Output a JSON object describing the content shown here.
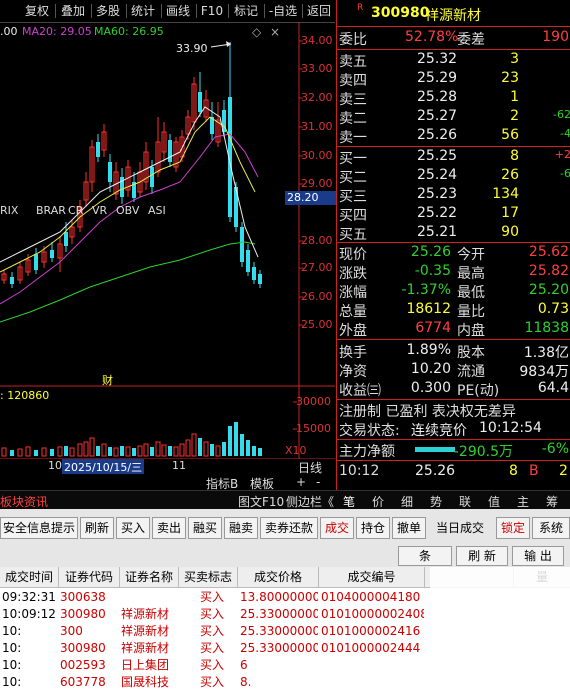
{
  "toolbar": {
    "buttons": [
      "复权",
      "叠加",
      "多股",
      "统计",
      "画线",
      "F10",
      "标记",
      "-自选",
      "返回"
    ]
  },
  "chart": {
    "ma_legend": {
      "ma_prev": ".00",
      "ma20": "MA20: 29.05",
      "ma60": "MA60: 26.95"
    },
    "high_marker": "33.90",
    "price_axis": [
      "34.00",
      "33.00",
      "32.00",
      "31.00",
      "30.00",
      "29.00",
      "28.00",
      "27.00",
      "26.00",
      "25.00",
      "24.00"
    ],
    "current_price_tag": "28.20",
    "indicator_tags": [
      "RIX",
      "BRAR",
      "CR",
      "VR",
      "OBV",
      "ASI"
    ],
    "financial_marker": "财",
    "volume_label": ": 120860",
    "volume_axis": [
      "30000",
      "15000"
    ],
    "volume_scale": "X10",
    "date_row": {
      "left": "10",
      "date": "2025/10/15/三",
      "right": "11"
    },
    "bottom_buttons": [
      "指标B",
      "模板",
      "+",
      "-",
      "日线"
    ]
  },
  "quote": {
    "badge": "R",
    "code": "300980",
    "name": "祥源新材",
    "weibi_label": "委比",
    "weibi_value": "52.78%",
    "weicha_label": "委差",
    "weicha_value": "190",
    "asks": [
      {
        "label": "卖五",
        "price": "25.32",
        "vol": "3",
        "chg": ""
      },
      {
        "label": "卖四",
        "price": "25.29",
        "vol": "23",
        "chg": ""
      },
      {
        "label": "卖三",
        "price": "25.28",
        "vol": "1",
        "chg": ""
      },
      {
        "label": "卖二",
        "price": "25.27",
        "vol": "2",
        "chg": "-62"
      },
      {
        "label": "卖一",
        "price": "25.26",
        "vol": "56",
        "chg": "-4"
      }
    ],
    "bids": [
      {
        "label": "买一",
        "price": "25.25",
        "vol": "8",
        "chg": "+2"
      },
      {
        "label": "买二",
        "price": "25.24",
        "vol": "26",
        "chg": "-6"
      },
      {
        "label": "买三",
        "price": "25.23",
        "vol": "134",
        "chg": ""
      },
      {
        "label": "买四",
        "price": "25.22",
        "vol": "17",
        "chg": ""
      },
      {
        "label": "买五",
        "price": "25.21",
        "vol": "90",
        "chg": ""
      }
    ],
    "stats": [
      {
        "l1": "现价",
        "v1": "25.26",
        "l2": "今开",
        "v2": "25.62"
      },
      {
        "l1": "涨跌",
        "v1": "-0.35",
        "l2": "最高",
        "v2": "25.82"
      },
      {
        "l1": "涨幅",
        "v1": "-1.37%",
        "l2": "最低",
        "v2": "25.20"
      },
      {
        "l1": "总量",
        "v1": "18612",
        "l2": "量比",
        "v2": "0.73"
      },
      {
        "l1": "外盘",
        "v1": "6774",
        "l2": "内盘",
        "v2": "11838"
      }
    ],
    "stats2": [
      {
        "l1": "换手",
        "v1": "1.89%",
        "l2": "股本",
        "v2": "1.38亿"
      },
      {
        "l1": "净资",
        "v1": "10.20",
        "l2": "流通",
        "v2": "9834万"
      },
      {
        "l1": "收益㈢",
        "v1": "0.300",
        "l2": "PE(动)",
        "v2": "64.4"
      }
    ],
    "registration": "注册制 已盈利 表决权无差异",
    "trade_status_label": "交易状态:",
    "trade_status_value": "连续竞价",
    "trade_status_time": "10:12:54",
    "main_net_label": "主力净额",
    "main_net_value": "-290.5万",
    "main_net_pct": "-6%",
    "tick": {
      "time": "10:12",
      "price": "25.26",
      "vol": "8",
      "side": "B",
      "n": "2"
    }
  },
  "tabs": {
    "left": "板块资讯",
    "mid": [
      "图文F10",
      "侧边栏《"
    ],
    "right": [
      "笔",
      "价",
      "细",
      "势",
      "联",
      "值",
      "主",
      "筹"
    ]
  },
  "trade": {
    "buttons": [
      "安全信息提示",
      "刷新",
      "买入",
      "卖出",
      "融买",
      "融卖",
      "卖券还款",
      "成交",
      "持仓",
      "撤单",
      "当日成交",
      "锁定",
      "系统"
    ],
    "actions": [
      "条",
      "刷 新",
      "输 出"
    ],
    "headers": [
      "成交时间",
      "证券代码",
      "证券名称",
      "买卖标志",
      "成交价格",
      "成交编号",
      "",
      "",
      "量"
    ],
    "rows": [
      {
        "time": "09:32:31",
        "code": "300638",
        "name": "",
        "side": "买入",
        "price": "13.80000000",
        "no": "0104000004180"
      },
      {
        "time": "10:09:12",
        "code": "300980",
        "name": "祥源新材",
        "side": "买入",
        "price": "25.33000000",
        "no": "01010000002408"
      },
      {
        "time": "10:",
        "code": "300",
        "name": "祥源新材",
        "side": "买入",
        "price": "25.33000000",
        "no": "0101000002416"
      },
      {
        "time": "10:",
        "code": "300980",
        "name": "祥源新材",
        "side": "买入",
        "price": "25.33000000",
        "no": "0101000002444"
      },
      {
        "time": "10:",
        "code": "002593",
        "name": "日上集团",
        "side": "买入",
        "price": "6",
        "no": ""
      },
      {
        "time": "10:",
        "code": "603778",
        "name": "国晟科技",
        "side": "买入",
        "price": "8.",
        "no": ""
      }
    ]
  }
}
